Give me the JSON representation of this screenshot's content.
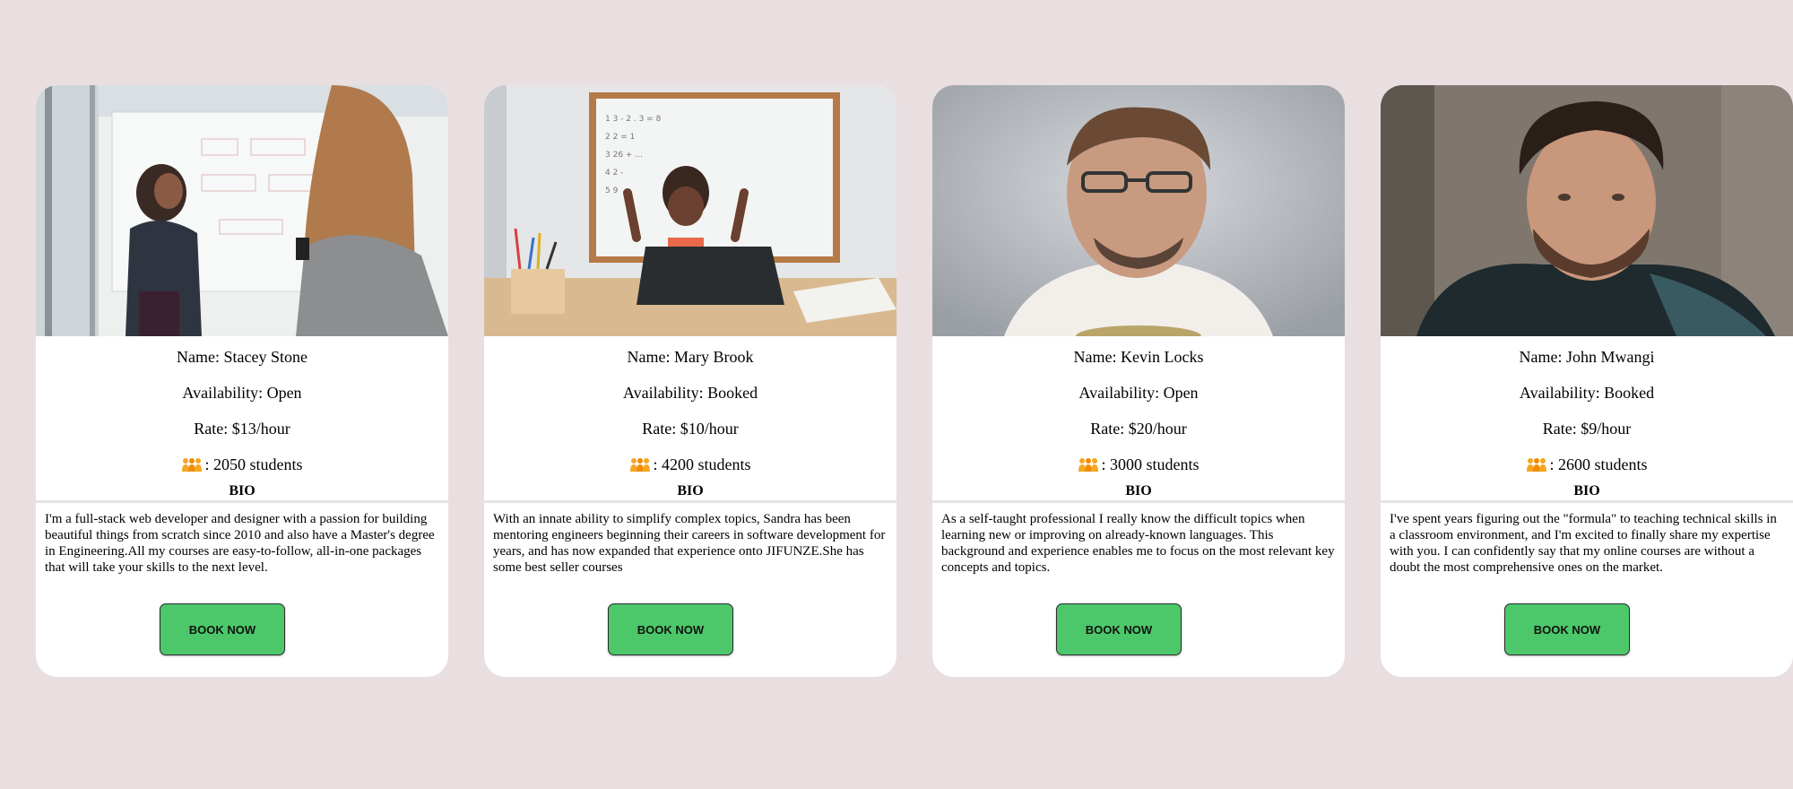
{
  "page": {
    "background_color": "#e9dfe0",
    "card_color": "#ffffff",
    "button_color": "#4cc86a"
  },
  "tutors": [
    {
      "name_text": "Name: Stacey Stone",
      "availability_text": "Availability: Open",
      "rate_text": "Rate: $13/hour",
      "students_text": ": 2050 students",
      "bio_title": "BIO",
      "bio": "I'm a full-stack web developer and designer with a passion for building beautiful things from scratch since 2010 and also have a Master's degree in Engineering.All my courses are easy-to-follow, all-in-one packages that will take your skills to the next level.",
      "button_label": "BOOK NOW",
      "photo_desc": "two women at a whiteboard"
    },
    {
      "name_text": "Name: Mary Brook",
      "availability_text": "Availability: Booked",
      "rate_text": "Rate: $10/hour",
      "students_text": ": 4200 students",
      "bio_title": "BIO",
      "bio": "With an innate ability to simplify complex topics, Sandra has been mentoring engineers beginning their careers in software development for years, and has now expanded that experience onto JIFUNZE.She has some best seller courses",
      "button_label": "BOOK NOW",
      "photo_desc": "woman celebrating at laptop in front of whiteboard"
    },
    {
      "name_text": "Name: Kevin Locks",
      "availability_text": "Availability: Open",
      "rate_text": "Rate: $20/hour",
      "students_text": ": 3000 students",
      "bio_title": "BIO",
      "bio": "As a self-taught professional I really know the difficult topics when learning new or improving on already-known languages. This background and experience enables me to focus on the most relevant key concepts and topics.",
      "button_label": "BOOK NOW",
      "photo_desc": "smiling man with glasses"
    },
    {
      "name_text": "Name: John Mwangi",
      "availability_text": "Availability: Booked",
      "rate_text": "Rate: $9/hour",
      "students_text": ": 2600 students",
      "bio_title": "BIO",
      "bio": "I've spent years figuring out the \"formula\" to teaching technical skills in a classroom environment, and I'm excited to finally share my expertise with you. I can confidently say that my online courses are without a doubt the most comprehensive ones on the market.",
      "button_label": "BOOK NOW",
      "photo_desc": "bearded man in dark hoodie"
    }
  ],
  "icons": {
    "students": "people-group-icon"
  }
}
